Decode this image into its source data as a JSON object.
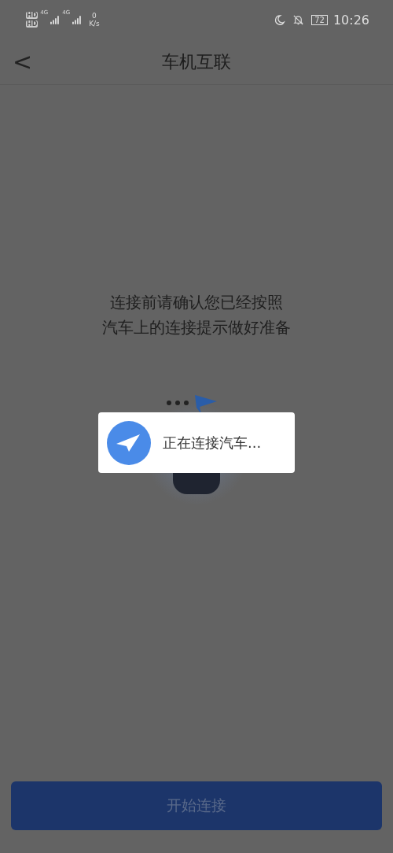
{
  "status_bar": {
    "sim_labels": [
      "HD",
      "HD"
    ],
    "networks": [
      "4G",
      "4G"
    ],
    "speed_value": "0",
    "speed_unit": "K/s",
    "battery": "72",
    "time": "10:26"
  },
  "nav": {
    "back": "<",
    "title": "车机互联"
  },
  "instruction": [
    "连接前请确认您已经按照",
    "汽车上的连接提示做好准备"
  ],
  "dialog": {
    "message": "正在连接汽车..."
  },
  "start_button": {
    "label": "开始连接",
    "disabled": true
  }
}
